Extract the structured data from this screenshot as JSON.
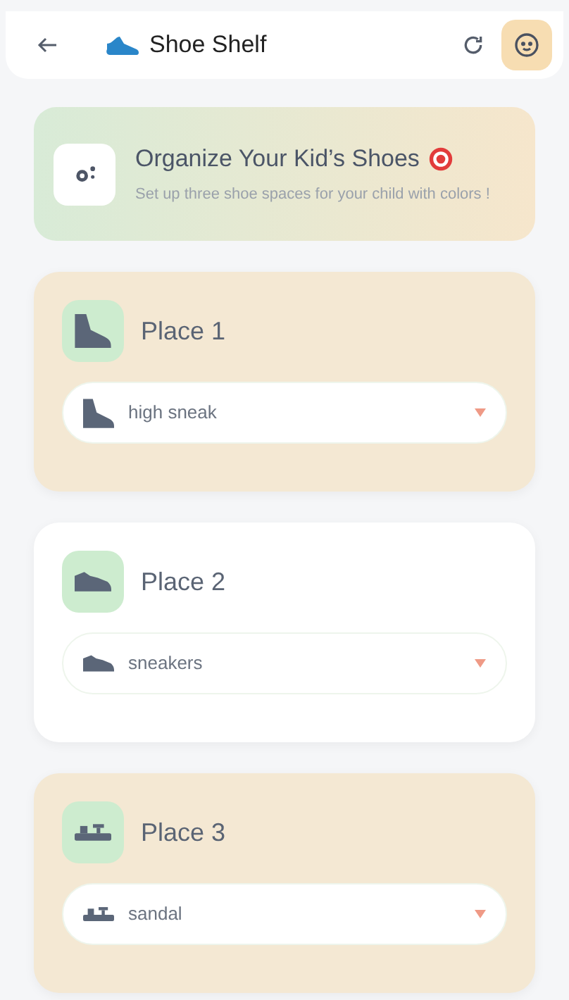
{
  "header": {
    "title": "Shoe Shelf"
  },
  "banner": {
    "title": "Organize Your Kid’s Shoes",
    "subtitle": "Set up three shoe spaces for your child with colors !"
  },
  "places": [
    {
      "title": "Place 1",
      "kind": "high",
      "color": "#f4e8d3",
      "value": "high sneak"
    },
    {
      "title": "Place 2",
      "kind": "sneaker",
      "color": "#ffffff",
      "value": "sneakers"
    },
    {
      "title": "Place 3",
      "kind": "sandal",
      "color": "#f4e8d3",
      "value": "sandal"
    }
  ]
}
